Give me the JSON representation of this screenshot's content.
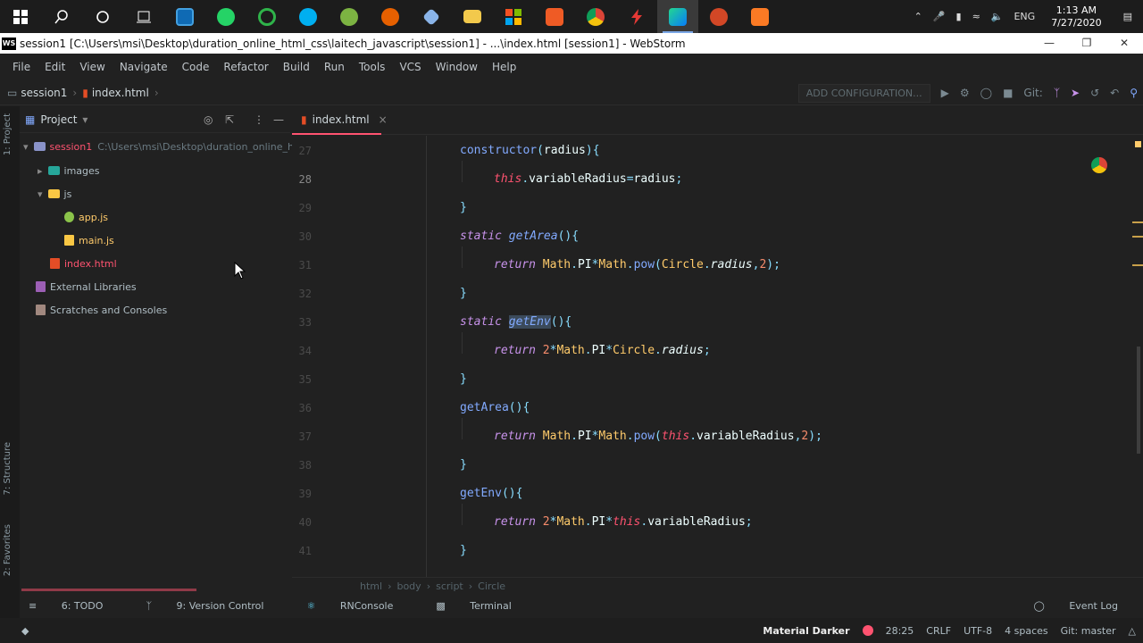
{
  "taskbar": {
    "icons": [
      "windows-start-icon",
      "search-icon",
      "cortana-icon",
      "task-view-icon",
      "app-e-icon",
      "whatsapp-icon",
      "chromium-icon",
      "skype-icon",
      "android-icon",
      "firefox-icon",
      "vscode-icon",
      "file-explorer-icon",
      "microsoft-store-icon",
      "postman-icon",
      "chrome-icon",
      "lightning-icon",
      "webstorm-icon",
      "powerpoint-icon",
      "xampp-icon"
    ],
    "tray_lang": "ENG",
    "time": "1:13 AM",
    "date": "7/27/2020"
  },
  "titlebar": {
    "logo": "WS",
    "title": "session1 [C:\\Users\\msi\\Desktop\\duration_online_html_css\\laitech_javascript\\session1] - ...\\index.html [session1] - WebStorm"
  },
  "menu": [
    "File",
    "Edit",
    "View",
    "Navigate",
    "Code",
    "Refactor",
    "Build",
    "Run",
    "Tools",
    "VCS",
    "Window",
    "Help"
  ],
  "navbar": {
    "project": "session1",
    "file": "index.html",
    "add_config": "ADD CONFIGURATION...",
    "git": "Git:"
  },
  "leftstripe": {
    "project_tab": "1: Project",
    "structure_tab": "7: Structure",
    "favorites_tab": "2: Favorites"
  },
  "project_panel": {
    "title": "Project",
    "root_name": "session1",
    "root_path": "C:\\Users\\msi\\Desktop\\duration_online_html_",
    "images": "images",
    "js": "js",
    "app_js": "app.js",
    "main_js": "main.js",
    "index_html": "index.html",
    "external_libraries": "External Libraries",
    "scratches": "Scratches and Consoles"
  },
  "editor": {
    "tab": "index.html",
    "line_numbers": [
      "27",
      "28",
      "29",
      "30",
      "31",
      "32",
      "33",
      "34",
      "35",
      "36",
      "37",
      "38",
      "39",
      "40",
      "41"
    ]
  },
  "breadcrumb": [
    "html",
    "body",
    "script",
    "Circle"
  ],
  "toolwindows": [
    "6: TODO",
    "9: Version Control",
    "RNConsole",
    "Terminal",
    "Event Log"
  ],
  "status": {
    "theme": "Material Darker",
    "position": "28:25",
    "line_sep": "CRLF",
    "encoding": "UTF-8",
    "indent": "4 spaces",
    "branch": "Git: master"
  },
  "colors": {
    "accent": "#ff5370",
    "bg": "#212121",
    "keyword": "#c792ea",
    "function": "#82aaff",
    "number": "#f78c6c",
    "class": "#ffcb6b"
  }
}
